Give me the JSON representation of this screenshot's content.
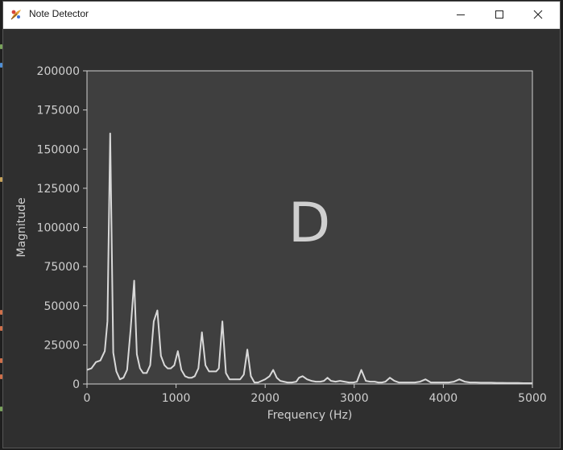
{
  "window": {
    "title": "Note Detector"
  },
  "icons": {
    "app": "tkinter-feather-icon",
    "minimize": "minimize-icon",
    "maximize": "maximize-icon",
    "close": "close-icon"
  },
  "plot": {
    "note_label": "D",
    "xlabel": "Frequency (Hz)",
    "ylabel": "Magnitude",
    "colors": {
      "figure_bg": "#2f2f2f",
      "axes_bg": "#3f3f3f",
      "line": "#d9d9d9",
      "text": "#cfcfcf"
    }
  },
  "chart_data": {
    "type": "line",
    "title": "",
    "xlabel": "Frequency (Hz)",
    "ylabel": "Magnitude",
    "xlim": [
      0,
      5000
    ],
    "ylim": [
      0,
      200000
    ],
    "xticks": [
      "0",
      "1000",
      "2000",
      "3000",
      "4000",
      "5000"
    ],
    "yticks": [
      "0",
      "25000",
      "50000",
      "75000",
      "100000",
      "125000",
      "150000",
      "175000",
      "200000"
    ],
    "grid": false,
    "annotation": "D",
    "series": [
      {
        "x": [
          0,
          50,
          100,
          150,
          200,
          230,
          260,
          295,
          330,
          370,
          410,
          450,
          490,
          530,
          560,
          595,
          630,
          670,
          710,
          750,
          790,
          830,
          870,
          905,
          940,
          980,
          1020,
          1060,
          1100,
          1140,
          1175,
          1210,
          1250,
          1290,
          1330,
          1370,
          1410,
          1450,
          1480,
          1520,
          1560,
          1600,
          1640,
          1680,
          1720,
          1760,
          1800,
          1840,
          1880,
          1920,
          1960,
          2000,
          2050,
          2090,
          2130,
          2170,
          2210,
          2250,
          2300,
          2350,
          2380,
          2420,
          2470,
          2520,
          2570,
          2620,
          2660,
          2700,
          2740,
          2790,
          2840,
          2890,
          2940,
          2990,
          3030,
          3080,
          3130,
          3180,
          3230,
          3270,
          3310,
          3350,
          3400,
          3450,
          3500,
          3560,
          3620,
          3680,
          3740,
          3800,
          3860,
          3920,
          3960,
          4000,
          4060,
          4120,
          4180,
          4240,
          4300,
          4360,
          4420,
          4480,
          4540,
          4600,
          4660,
          4720,
          4780,
          4840,
          4900,
          4950,
          5000
        ],
        "y": [
          9000,
          10000,
          14000,
          15000,
          21000,
          40000,
          160000,
          20000,
          8000,
          3000,
          4000,
          9000,
          35000,
          66000,
          19000,
          10000,
          7000,
          7000,
          12000,
          40000,
          47000,
          18000,
          12000,
          10000,
          10000,
          12000,
          21000,
          9000,
          5000,
          4000,
          4000,
          5000,
          10000,
          33000,
          12000,
          8000,
          8000,
          8000,
          10000,
          40000,
          7000,
          3000,
          3000,
          3000,
          3000,
          6000,
          22000,
          5000,
          1000,
          1000,
          2000,
          3000,
          5000,
          9000,
          4000,
          2000,
          1500,
          1000,
          1000,
          1500,
          4000,
          5000,
          3000,
          2000,
          1500,
          1500,
          2000,
          4000,
          2000,
          1500,
          2000,
          1500,
          1000,
          1000,
          1500,
          9000,
          2000,
          1500,
          1500,
          1000,
          1000,
          1500,
          4000,
          2000,
          1000,
          1000,
          1000,
          1000,
          1500,
          3000,
          1000,
          1000,
          1000,
          1000,
          1000,
          1500,
          3000,
          1500,
          1000,
          1000,
          800,
          800,
          800,
          700,
          700,
          600,
          600,
          600,
          500,
          500,
          500
        ]
      }
    ]
  }
}
